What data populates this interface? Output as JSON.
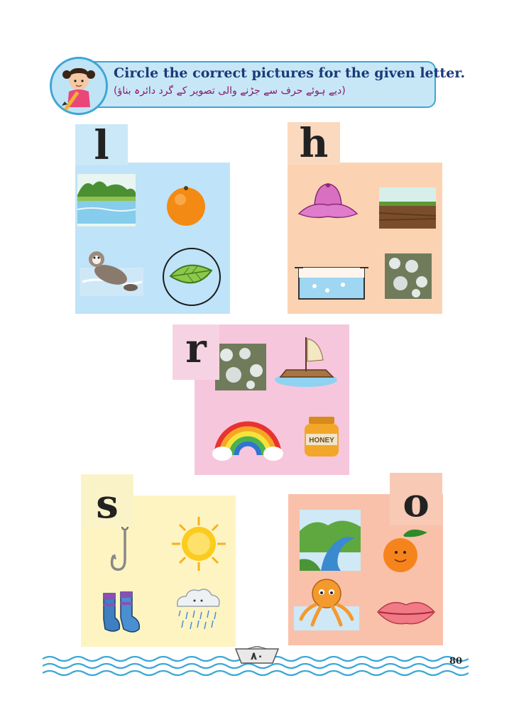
{
  "header": {
    "title": "Circle the correct pictures for the given letter.",
    "urdu_instruction": "(دیے ہوئے حرف سے جڑنے والی تصویر کے گرد دائرہ بناؤ)"
  },
  "cards": [
    {
      "letter": "l",
      "color": "#bfe3f8",
      "pictures": [
        "lake",
        "orange",
        "otter",
        "leaf"
      ],
      "circled": "leaf"
    },
    {
      "letter": "h",
      "color": "#fbd3b3",
      "pictures": [
        "hat",
        "soil",
        "water-tank",
        "hailstones"
      ]
    },
    {
      "letter": "r",
      "color": "#f6c6dc",
      "pictures": [
        "hailstones",
        "raft",
        "rainbow",
        "honey-jar"
      ],
      "honey_label": "HONEY"
    },
    {
      "letter": "s",
      "color": "#fdf4c2",
      "pictures": [
        "hook",
        "sun",
        "socks",
        "rain-cloud"
      ]
    },
    {
      "letter": "o",
      "color": "#f9c1aa",
      "pictures": [
        "river",
        "orange",
        "octopus",
        "lips"
      ]
    }
  ],
  "footer": {
    "badge_text": "۸۰",
    "page_number": "80"
  }
}
